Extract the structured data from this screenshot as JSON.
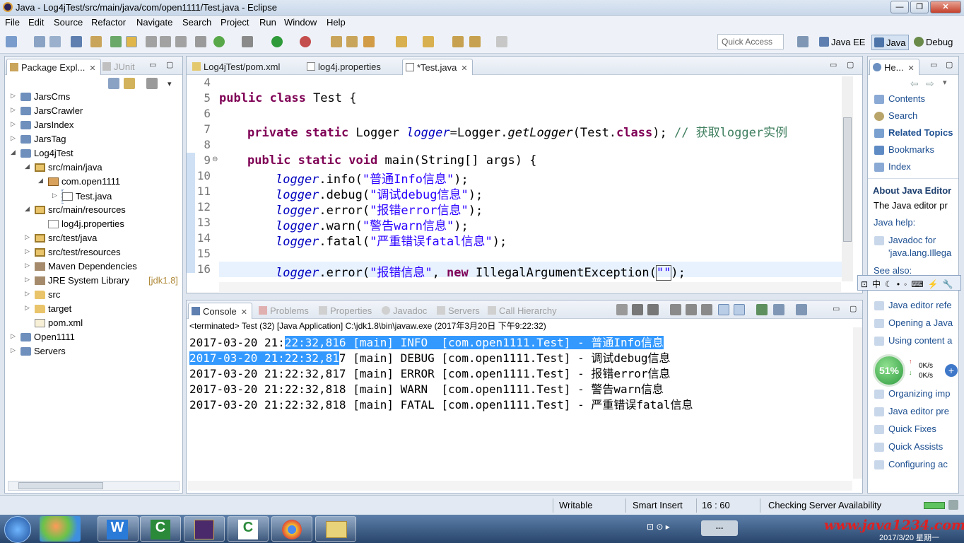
{
  "window": {
    "title": "Java - Log4jTest/src/main/java/com/open1111/Test.java - Eclipse"
  },
  "menu": [
    "File",
    "Edit",
    "Source",
    "Refactor",
    "Navigate",
    "Search",
    "Project",
    "Run",
    "Window",
    "Help"
  ],
  "toolbar": {
    "quick_access": "Quick Access",
    "perspectives": [
      "Java EE",
      "Java",
      "Debug"
    ]
  },
  "package_explorer": {
    "tabs": [
      "Package Expl...",
      "JUnit"
    ],
    "tree": [
      {
        "label": "JarsCms",
        "icon": "project-icon"
      },
      {
        "label": "JarsCrawler",
        "icon": "project-icon"
      },
      {
        "label": "JarsIndex",
        "icon": "project-icon"
      },
      {
        "label": "JarsTag",
        "icon": "project-icon"
      },
      {
        "label": "Log4jTest",
        "icon": "project-icon",
        "expanded": true
      },
      {
        "label": "src/main/java",
        "icon": "source-folder-icon",
        "expanded": true
      },
      {
        "label": "com.open1111",
        "icon": "package-icon",
        "expanded": true
      },
      {
        "label": "Test.java",
        "icon": "java-file-icon",
        "selected": true
      },
      {
        "label": "src/main/resources",
        "icon": "source-folder-icon",
        "expanded": true
      },
      {
        "label": "log4j.properties",
        "icon": "file-icon"
      },
      {
        "label": "src/test/java",
        "icon": "source-folder-icon"
      },
      {
        "label": "src/test/resources",
        "icon": "source-folder-icon"
      },
      {
        "label": "Maven Dependencies",
        "icon": "library-icon"
      },
      {
        "label": "JRE System Library",
        "icon": "library-icon",
        "decoration": "[jdk1.8]"
      },
      {
        "label": "src",
        "icon": "folder-icon"
      },
      {
        "label": "target",
        "icon": "folder-icon"
      },
      {
        "label": "pom.xml",
        "icon": "xml-file-icon"
      },
      {
        "label": "Open1111",
        "icon": "project-icon"
      },
      {
        "label": "Servers",
        "icon": "project-icon"
      }
    ]
  },
  "editor": {
    "tabs": [
      "Log4jTest/pom.xml",
      "log4j.properties",
      "*Test.java"
    ],
    "line_numbers": [
      "4",
      "5",
      "6",
      "7",
      "8",
      "9",
      "10",
      "11",
      "12",
      "13",
      "14",
      "15",
      "16"
    ],
    "code": {
      "l5_kw": "public class",
      "l5_rest": " Test {",
      "l7_kw": "private static",
      "l7_type": " Logger ",
      "l7_field": "logger",
      "l7_eq": "=Logger.",
      "l7_method": "getLogger",
      "l7_arg": "(Test.",
      "l7_class": "class",
      "l7_end": "); ",
      "l7_comment": "// 获取logger实例",
      "l9_kw": "public static void",
      "l9_rest": " main(String[] args) {",
      "l10_field": "logger",
      "l10_call": ".info(",
      "l10_str": "\"普通Info信息\"",
      "l10_end": ");",
      "l11_field": "logger",
      "l11_call": ".debug(",
      "l11_str": "\"调试debug信息\"",
      "l11_end": ");",
      "l12_field": "logger",
      "l12_call": ".error(",
      "l12_str": "\"报错error信息\"",
      "l12_end": ");",
      "l13_field": "logger",
      "l13_call": ".warn(",
      "l13_str": "\"警告warn信息\"",
      "l13_end": ");",
      "l14_field": "logger",
      "l14_call": ".fatal(",
      "l14_str": "\"严重错误fatal信息\"",
      "l14_end": ");",
      "l16_field": "logger",
      "l16_call": ".error(",
      "l16_str": "\"报错信息\"",
      "l16_mid": ", ",
      "l16_kw": "new",
      "l16_rest": " IllegalArgumentException(",
      "l16_str2": "\"\"",
      "l16_end": ");"
    }
  },
  "console": {
    "tabs": [
      "Console",
      "Problems",
      "Properties",
      "Javadoc",
      "Servers",
      "Call Hierarchy"
    ],
    "terminated": "<terminated> Test (32) [Java Application] C:\\jdk1.8\\bin\\javaw.exe (2017年3月20日 下午9:22:32)",
    "lines": [
      {
        "a": "2017-03-20 21:",
        "b": "22:32,816 [main] INFO  [com.open1111.Test] - 普通Info信息",
        "c": ""
      },
      {
        "a": "",
        "b": "2017-03-20 21:22:32,81",
        "c": "7 [main] DEBUG [com.open1111.Test] - 调试debug信息"
      },
      {
        "a": "2017-03-20 21:22:32,817 [main] ERROR [com.open1111.Test] - 报错error信息",
        "b": "",
        "c": ""
      },
      {
        "a": "2017-03-20 21:22:32,818 [main] WARN  [com.open1111.Test] - 警告warn信息",
        "b": "",
        "c": ""
      },
      {
        "a": "2017-03-20 21:22:32,818 [main] FATAL [com.open1111.Test] - 严重错误fatal信息",
        "b": "",
        "c": ""
      }
    ]
  },
  "help": {
    "tab": "He...",
    "links": [
      "Contents",
      "Search",
      "Related Topics",
      "Bookmarks",
      "Index"
    ],
    "about_title": "About Java Editor",
    "about_text": "The Java editor pr",
    "java_help": "Java help:",
    "javadoc_link1": "Javadoc for",
    "javadoc_link2": "'java.lang.Illega",
    "see_also": "See also:",
    "more_links": [
      "Java editor refe",
      "Opening a Java",
      "Using content a",
      "Organizing imp",
      "Java editor pre",
      "Quick Fixes",
      "Quick Assists",
      "Configuring ac"
    ],
    "net_percent": "51%",
    "net_up": "0K/s",
    "net_down": "0K/s"
  },
  "status": {
    "writable": "Writable",
    "insert": "Smart Insert",
    "position": "16 : 60",
    "task": "Checking Server Availability"
  },
  "taskbar": {
    "watermark": "www.java1234.com",
    "time": "2017/3/20 星期一"
  }
}
